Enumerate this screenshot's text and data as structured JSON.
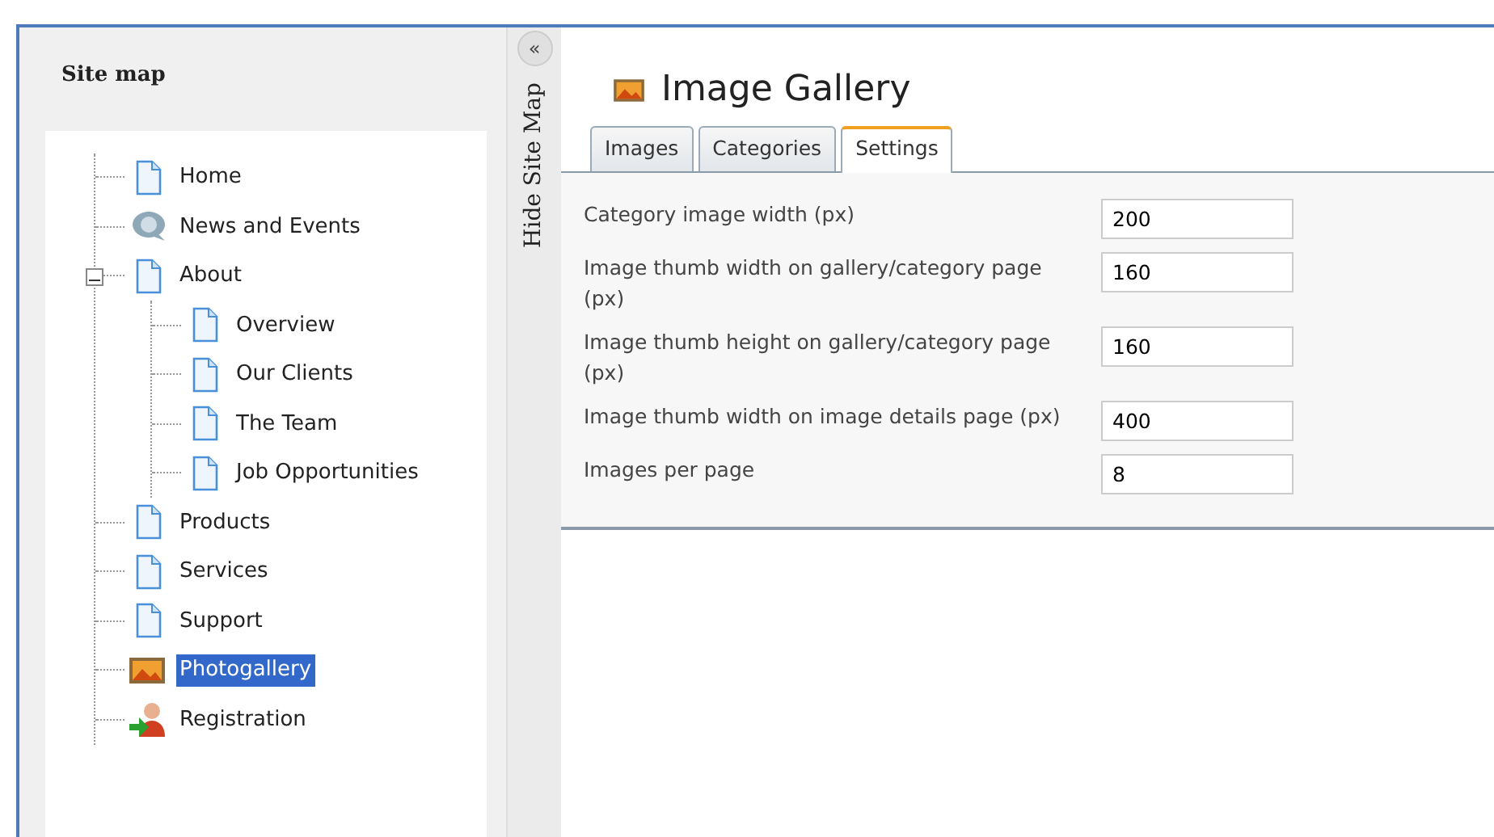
{
  "sidebar": {
    "title": "Site map",
    "tree": [
      {
        "label": "Home",
        "kind": "page",
        "selected": false
      },
      {
        "label": "News and Events",
        "kind": "news",
        "selected": false
      },
      {
        "label": "About",
        "kind": "page",
        "selected": false,
        "expanded": true,
        "children": [
          {
            "label": "Overview",
            "kind": "page",
            "selected": false
          },
          {
            "label": "Our Clients",
            "kind": "page",
            "selected": false
          },
          {
            "label": "The Team",
            "kind": "page",
            "selected": false
          },
          {
            "label": "Job Opportunities",
            "kind": "page",
            "selected": false
          }
        ]
      },
      {
        "label": "Products",
        "kind": "page",
        "selected": false
      },
      {
        "label": "Services",
        "kind": "page",
        "selected": false
      },
      {
        "label": "Support",
        "kind": "page",
        "selected": false
      },
      {
        "label": "Photogallery",
        "kind": "gallery",
        "selected": true
      },
      {
        "label": "Registration",
        "kind": "user",
        "selected": false
      }
    ]
  },
  "splitter": {
    "collapse_glyph": "«",
    "label": "Hide Site Map"
  },
  "main": {
    "title": "Image Gallery",
    "tabs": [
      {
        "label": "Images",
        "selected": false
      },
      {
        "label": "Categories",
        "selected": false
      },
      {
        "label": "Settings",
        "selected": true
      }
    ],
    "settings": [
      {
        "label": "Category image width (px)",
        "value": "200"
      },
      {
        "label": "Image thumb width on gallery/category page (px)",
        "value": "160"
      },
      {
        "label": "Image thumb height on gallery/category page (px)",
        "value": "160"
      },
      {
        "label": "Image thumb width on image details page (px)",
        "value": "400"
      },
      {
        "label": "Images per page",
        "value": "8"
      }
    ]
  }
}
